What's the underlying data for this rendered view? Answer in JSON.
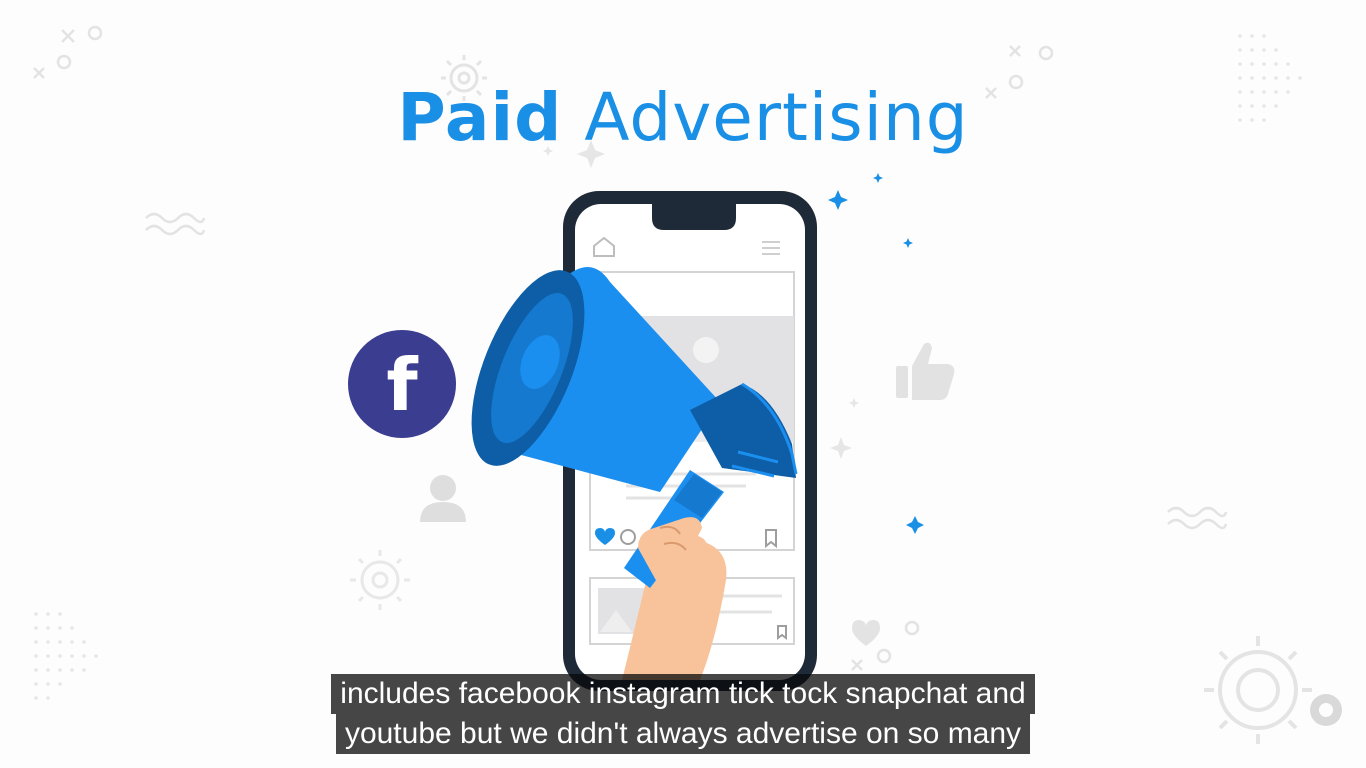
{
  "title": {
    "bold": "Paid",
    "light": "Advertising"
  },
  "colors": {
    "accent_blue": "#1a8fe6",
    "megaphone_blue": "#1b8ff0",
    "megaphone_dark": "#0d5ea6",
    "facebook_circle": "#3b3d91",
    "phone_frame": "#1f2a38",
    "skin": "#f8c39a",
    "caption_bg": "#141414"
  },
  "icons": {
    "phone_home": "home-icon",
    "phone_menu": "menu-icon",
    "facebook": "facebook-icon",
    "like": "thumbs-up-icon",
    "user": "user-icon",
    "heart": "heart-icon",
    "comment": "comment-icon",
    "bookmark": "bookmark-icon",
    "megaphone": "megaphone-icon"
  },
  "facebook_glyph": "f",
  "captions": [
    "includes facebook instagram tick tock snapchat and",
    "youtube but we didn't always advertise on so many"
  ]
}
